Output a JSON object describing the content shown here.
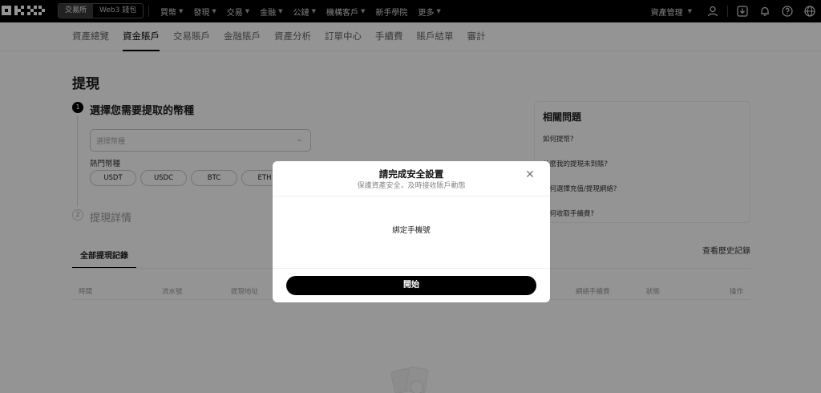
{
  "topnav": {
    "segment": [
      "交易所",
      "Web3 錢包"
    ],
    "menu": [
      "買幣",
      "發現",
      "交易",
      "金融",
      "公鏈",
      "機構客戶",
      "新手學院",
      "更多"
    ],
    "asset_management": "資產管理",
    "icons": [
      "user-icon",
      "download-icon",
      "bell-icon",
      "help-icon",
      "globe-icon"
    ]
  },
  "subnav": {
    "tabs": [
      "資產總覽",
      "資金賬戶",
      "交易賬戶",
      "金融賬戶",
      "資產分析",
      "訂單中心",
      "手續費",
      "賬戶結單",
      "審計"
    ],
    "active_index": 1
  },
  "page": {
    "title": "提現",
    "step1": {
      "num": "1",
      "title": "選擇您需要提取的幣種"
    },
    "coin_select_placeholder": "選擇幣種",
    "hot_label": "熱門幣種",
    "hot_coins": [
      "USDT",
      "USDC",
      "BTC",
      "ETH"
    ],
    "step2": {
      "num": "2",
      "title": "提現詳情"
    }
  },
  "faq": {
    "title": "相關問題",
    "items": [
      "如何提幣?",
      "什麼我的提現未到賬?",
      "如何選擇充值/提現網絡?",
      "如何收取手續費?"
    ]
  },
  "records": {
    "tab": "全部提現記錄",
    "history_link": "查看歷史記錄",
    "columns": [
      "時間",
      "流水號",
      "提現地址",
      "網絡手續費",
      "狀態",
      "操作"
    ]
  },
  "modal": {
    "title": "請完成安全設置",
    "subtitle": "保護資產安全，及時接收賬戶動態",
    "body": "綁定手機號",
    "button": "開始"
  }
}
